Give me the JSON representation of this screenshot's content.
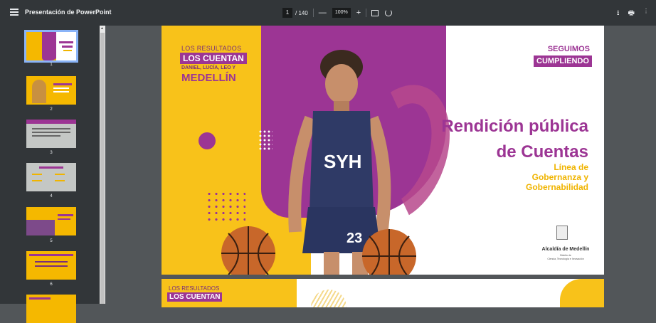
{
  "toolbar": {
    "title": "Presentación de PowerPoint",
    "current_page": "1",
    "total_pages": "/ 140",
    "zoom_out": "—",
    "zoom_level": "100%",
    "zoom_in": "+",
    "fit_icon": "fit-page-icon",
    "rotate_icon": "rotate-icon",
    "download_icon": "download-icon",
    "print_icon": "print-icon",
    "more_icon": "more-vert-icon"
  },
  "sidebar": {
    "thumbnails": [
      {
        "num": "1"
      },
      {
        "num": "2"
      },
      {
        "num": "3"
      },
      {
        "num": "4"
      },
      {
        "num": "5"
      },
      {
        "num": "6"
      }
    ]
  },
  "slide1": {
    "brand_line1": "LOS RESULTADOS",
    "brand_line2": "LOS CUENTAN",
    "brand_line3": "DANIEL, LUCÍA, LEO Y",
    "brand_line4": "MEDELLÍN",
    "seguimos": "SEGUIMOS",
    "cumpliendo": "CUMPLIENDO",
    "title_line1": "Rendición pública",
    "title_line2": "de Cuentas",
    "subtitle_line1": "Línea de",
    "subtitle_line2": "Gobernanza y",
    "subtitle_line3": "Gobernabilidad",
    "jersey_text": "SYH",
    "ball_number": "23",
    "alcaldia": "Alcaldía de Medellín",
    "alcaldia_sub1": "Distrito de",
    "alcaldia_sub2": "Ciencia, Tecnología e Innovación"
  },
  "slide2": {
    "brand_line1": "LOS RESULTADOS",
    "brand_line2": "LOS CUENTAN"
  },
  "colors": {
    "purple": "#9c3594",
    "yellow": "#f8c21a",
    "toolbar": "#323639",
    "viewer_bg": "#525659"
  }
}
